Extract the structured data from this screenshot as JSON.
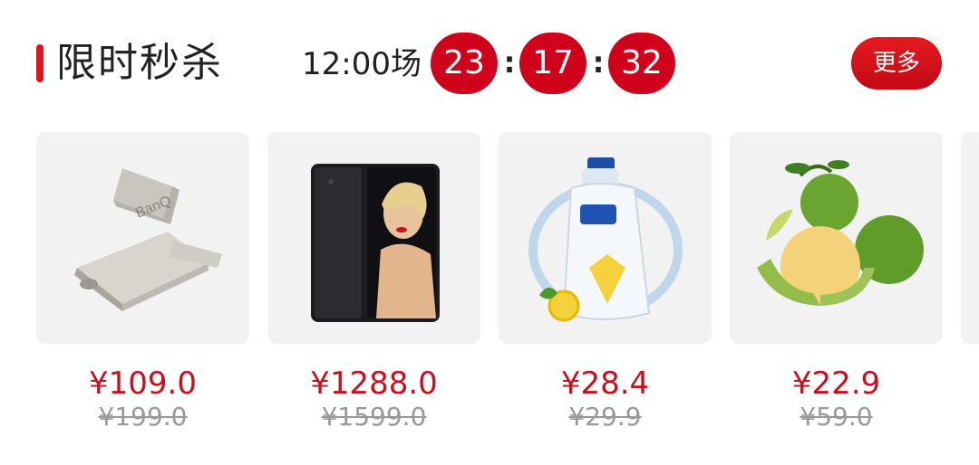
{
  "header": {
    "title": "限时秒杀",
    "session": "12:00场",
    "countdown": {
      "hours": "23",
      "minutes": "17",
      "seconds": "32",
      "separator": ":"
    },
    "more_label": "更多"
  },
  "products": [
    {
      "icon": "usb-drive-image",
      "price": "¥109.0",
      "original_price": "¥199.0"
    },
    {
      "icon": "smartphone-image",
      "price": "¥1288.0",
      "original_price": "¥1599.0"
    },
    {
      "icon": "body-wash-bottle-image",
      "price": "¥28.4",
      "original_price": "¥29.9"
    },
    {
      "icon": "oranges-image",
      "price": "¥22.9",
      "original_price": "¥59.0"
    }
  ],
  "colors": {
    "accent": "#d0011b",
    "price": "#c8101d",
    "card_bg": "#f2f2f2"
  }
}
